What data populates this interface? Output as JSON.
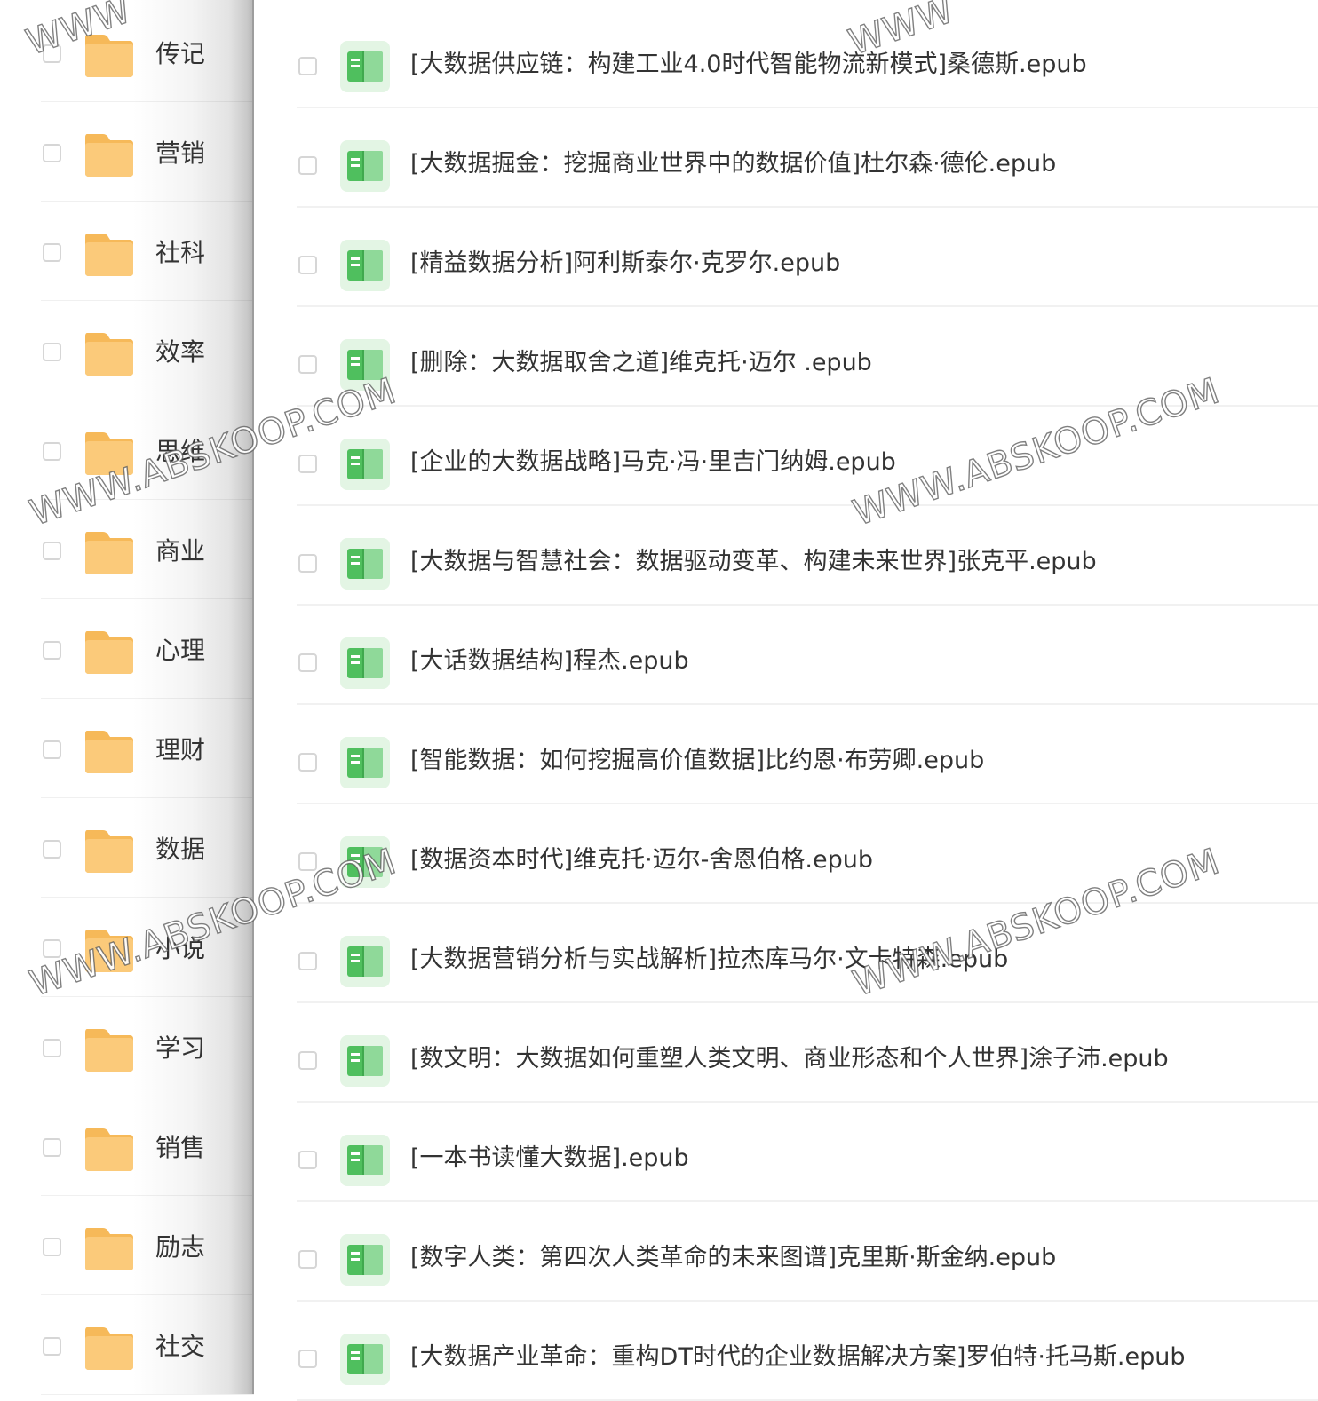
{
  "folders": [
    {
      "name": "传记"
    },
    {
      "name": "营销"
    },
    {
      "name": "社科"
    },
    {
      "name": "效率"
    },
    {
      "name": "思维"
    },
    {
      "name": "商业"
    },
    {
      "name": "心理"
    },
    {
      "name": "理财"
    },
    {
      "name": "数据"
    },
    {
      "name": "小说"
    },
    {
      "name": "学习"
    },
    {
      "name": "销售"
    },
    {
      "name": "励志"
    },
    {
      "name": "社交"
    }
  ],
  "files": [
    {
      "name": "[大数据供应链：构建工业4.0时代智能物流新模式]桑德斯.epub"
    },
    {
      "name": "[大数据掘金：挖掘商业世界中的数据价值]杜尔森·德伦.epub"
    },
    {
      "name": "[精益数据分析]阿利斯泰尔·克罗尔.epub"
    },
    {
      "name": "[删除：大数据取舍之道]维克托·迈尔 .epub"
    },
    {
      "name": "[企业的大数据战略]马克·冯·里吉门纳姆.epub"
    },
    {
      "name": "[大数据与智慧社会：数据驱动变革、构建未来世界]张克平.epub"
    },
    {
      "name": "[大话数据结构]程杰.epub"
    },
    {
      "name": "[智能数据：如何挖掘高价值数据]比约恩·布劳卿.epub"
    },
    {
      "name": "[数据资本时代]维克托·迈尔-舍恩伯格.epub"
    },
    {
      "name": "[大数据营销分析与实战解析]拉杰库马尔·文卡特森.epub"
    },
    {
      "name": "[数文明：大数据如何重塑人类文明、商业形态和个人世界]涂子沛.epub"
    },
    {
      "name": "[一本书读懂大数据].epub"
    },
    {
      "name": "[数字人类：第四次人类革命的未来图谱]克里斯·斯金纳.epub"
    },
    {
      "name": "[大数据产业革命：重构DT时代的企业数据解决方案]罗伯特·托马斯.epub"
    }
  ],
  "watermark": {
    "text": "WWW.ABSKOOP.COM",
    "partial_text": "WWW"
  },
  "icons": {
    "folder": "folder-icon",
    "file": "epub-book-icon",
    "folder_color": "#F9C776",
    "file_color": "#5CC668"
  }
}
